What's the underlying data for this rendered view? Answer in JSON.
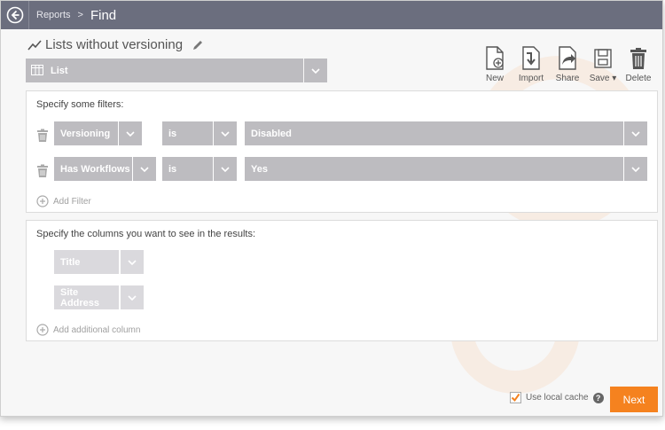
{
  "breadcrumb": {
    "parent": "Reports",
    "separator": ">",
    "current": "Find"
  },
  "report": {
    "title": "Lists without versioning"
  },
  "scope": {
    "value": "List"
  },
  "toolbar": {
    "new_label": "New",
    "import_label": "Import",
    "share_label": "Share",
    "save_label": "Save",
    "delete_label": "Delete"
  },
  "filters": {
    "title": "Specify some filters:",
    "rows": [
      {
        "field": "Versioning",
        "operator": "is",
        "value": "Disabled"
      },
      {
        "field": "Has Workflows",
        "operator": "is",
        "value": "Yes"
      }
    ],
    "add_label": "Add Filter"
  },
  "columns": {
    "title": "Specify the columns you want to see in the results:",
    "items": [
      "Title",
      "Site Address"
    ],
    "add_label": "Add additional column"
  },
  "footer": {
    "cache_label": "Use local cache",
    "cache_checked": true,
    "help_symbol": "?",
    "next_label": "Next"
  },
  "colors": {
    "titlebar": "#6b6e7e",
    "accent": "#f5821f",
    "select_bg": "#bdbcc0",
    "select_light_bg": "#dad9dd"
  }
}
